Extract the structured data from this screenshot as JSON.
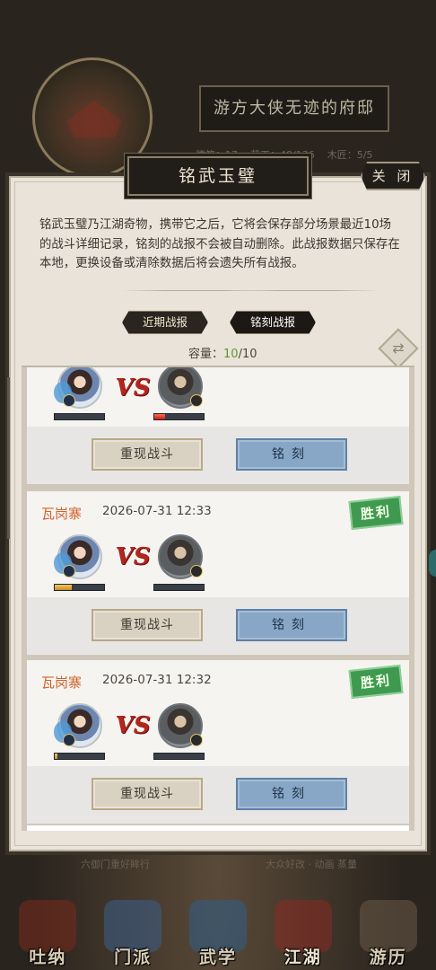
{
  "background": {
    "estate_title": "游方大侠无迹的府邸",
    "stats": [
      "建筑：17",
      "劳工：48/136",
      "木匠：5/5"
    ],
    "bottom_text_left": "六御门重好眸行",
    "bottom_text_right": "大众好改 · 动画 蒸量"
  },
  "dialog": {
    "title": "铭武玉璧",
    "close_label": "关 闭",
    "description": "铭武玉璧乃江湖奇物，携带它之后，它将会保存部分场景最近10场的战斗详细记录，铭刻的战报不会被自动删除。此战报数据只保存在本地，更换设备或清除数据后将会遗失所有战报。",
    "tabs": [
      {
        "label": "近期战报",
        "active": false
      },
      {
        "label": "铭刻战报",
        "active": true
      }
    ],
    "capacity_label": "容量：",
    "capacity_used": "10",
    "capacity_total": "/10",
    "refresh_icon": "refresh-icon"
  },
  "records": [
    {
      "location": "",
      "time": "",
      "victory": "",
      "player_hp": 0.0,
      "enemy_hp": 0.22,
      "replay_label": "重现战斗",
      "engrave_label": "铭刻"
    },
    {
      "location": "瓦岗寨",
      "time": "2026-07-31 12:33",
      "victory": "胜利",
      "player_hp": 0.35,
      "enemy_hp": 0.0,
      "replay_label": "重现战斗",
      "engrave_label": "铭刻"
    },
    {
      "location": "瓦岗寨",
      "time": "2026-07-31 12:32",
      "victory": "胜利",
      "player_hp": 0.05,
      "enemy_hp": 0.0,
      "replay_label": "重现战斗",
      "engrave_label": "铭刻"
    }
  ],
  "vs_label": "VS",
  "bottom_nav": [
    {
      "label": "吐纳",
      "icon": "tuna-icon",
      "color": "#7a2a1c"
    },
    {
      "label": "门派",
      "icon": "sect-icon",
      "color": "#3d5f8c"
    },
    {
      "label": "武学",
      "icon": "martial-arts-icon",
      "color": "#2e5f8a"
    },
    {
      "label": "江湖",
      "icon": "jianghu-icon",
      "color": "#8a2a22"
    },
    {
      "label": "游历",
      "icon": "travel-icon",
      "color": "#6a5a48"
    }
  ]
}
